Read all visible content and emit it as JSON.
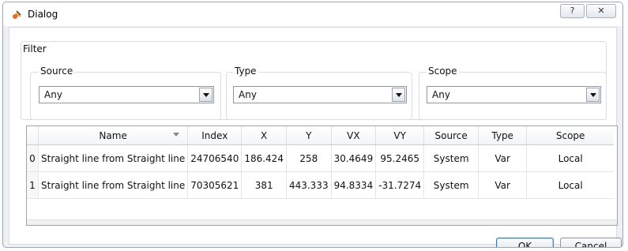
{
  "window": {
    "title": "Dialog",
    "help_label": "?",
    "close_label": "✕"
  },
  "filter": {
    "label": "Filter",
    "source": {
      "label": "Source",
      "value": "Any"
    },
    "type": {
      "label": "Type",
      "value": "Any"
    },
    "scope": {
      "label": "Scope",
      "value": "Any"
    }
  },
  "table": {
    "columns": [
      "",
      "Name",
      "Index",
      "X",
      "Y",
      "VX",
      "VY",
      "Source",
      "Type",
      "Scope"
    ],
    "rows": [
      [
        "0",
        "Straight line from Straight line",
        "24706540",
        "186.424",
        "258",
        "30.4649",
        "95.2465",
        "System",
        "Var",
        "Local"
      ],
      [
        "1",
        "Straight line from Straight line",
        "70305621",
        "381",
        "443.333",
        "94.8334",
        "-31.7274",
        "System",
        "Var",
        "Local"
      ]
    ]
  },
  "buttons": {
    "ok": "OK",
    "cancel": "Cancel"
  }
}
